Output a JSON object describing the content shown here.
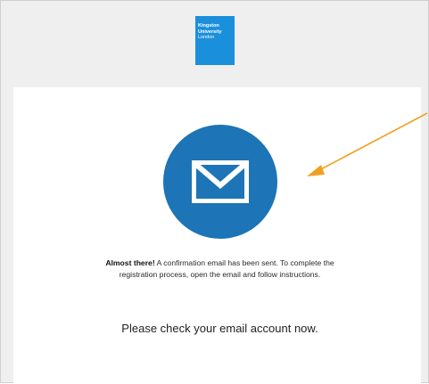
{
  "logo": {
    "line1": "Kingston",
    "line2": "University",
    "line3": "London"
  },
  "icons": {
    "envelope": "envelope-icon",
    "annotation": "arrow-pointer"
  },
  "message": {
    "lead": "Almost there!",
    "body": " A confirmation email has been sent. To complete the registration process, open the email and follow instructions."
  },
  "call_to_action": "Please check your email account now.",
  "colors": {
    "brand": "#1a8fdc",
    "envelope_circle": "#1d74b6",
    "arrow": "#f0a020"
  }
}
